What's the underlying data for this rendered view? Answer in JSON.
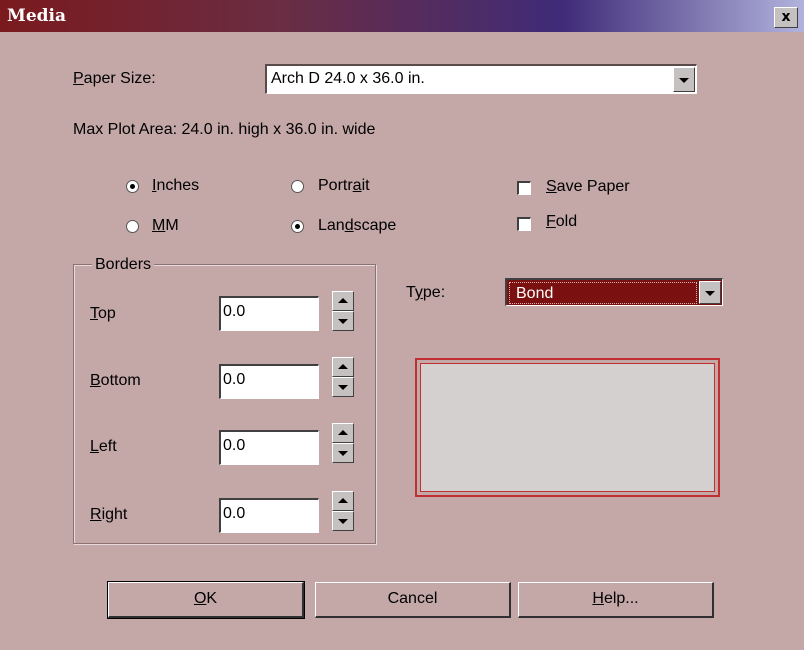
{
  "window": {
    "title": "Media",
    "close_label": "x"
  },
  "paper_size": {
    "label_prefix": "P",
    "label_mnemonic": "",
    "label_rest": "aper Size:",
    "label_underlined": "P",
    "value": "Arch D 24.0 x 36.0 in."
  },
  "max_plot_area": "Max Plot Area: 24.0 in. high x 36.0 in. wide",
  "units": {
    "inches": {
      "u": "I",
      "rest": "nches",
      "selected": true
    },
    "mm": {
      "u": "M",
      "rest": "M",
      "selected": false
    }
  },
  "orientation": {
    "portrait": {
      "pre": "Portr",
      "u": "a",
      "rest": "it",
      "selected": false
    },
    "landscape": {
      "pre": "Lan",
      "u": "d",
      "rest": "scape",
      "selected": true
    }
  },
  "options": {
    "save_paper": {
      "u": "S",
      "rest": "ave Paper",
      "checked": false
    },
    "fold": {
      "u": "F",
      "rest": "old",
      "checked": false
    }
  },
  "borders": {
    "title": "Borders",
    "top": {
      "u": "T",
      "rest": "op",
      "value": "0.0"
    },
    "bottom": {
      "u": "B",
      "rest": "ottom",
      "value": "0.0"
    },
    "left": {
      "u": "L",
      "rest": "eft",
      "value": "0.0"
    },
    "right": {
      "u": "R",
      "rest": "ight",
      "value": "0.0"
    }
  },
  "type": {
    "pre": "T",
    "u": "y",
    "rest": "pe:",
    "value": "Bond"
  },
  "buttons": {
    "ok": {
      "u": "O",
      "rest": "K"
    },
    "cancel": "Cancel",
    "help": {
      "u": "H",
      "rest": "elp..."
    }
  },
  "colors": {
    "dialog_bg": "#c4a7a7",
    "selection": "#7a1010",
    "preview_border": "#c03030"
  }
}
